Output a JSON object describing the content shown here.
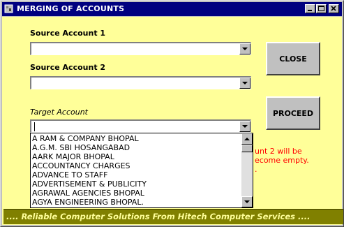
{
  "window": {
    "title": "MERGING OF ACCOUNTS",
    "titlebar_color": "#000080",
    "background_color": "#ffff99"
  },
  "source1": {
    "label": "Source Account 1",
    "value": ""
  },
  "source2": {
    "label": "Source Account 2",
    "value": ""
  },
  "target": {
    "label": "Target Account",
    "value": ""
  },
  "buttons": {
    "close_label": "CLOSE",
    "proceed_label": "PROCEED"
  },
  "notice": {
    "line1": "unt 2 will be",
    "line2": "ecome empty.",
    "line3": "."
  },
  "dropdown_items": [
    "A RAM & COMPANY BHOPAL",
    "A.G.M. SBI HOSANGABAD",
    "AARK MAJOR BHOPAL",
    "ACCOUNTANCY  CHARGES",
    "ADVANCE TO STAFF",
    "ADVERTISEMENT & PUBLICITY",
    "AGRAWAL AGENCIES BHOPAL",
    "AGYA ENGINEERING BHOPAL."
  ],
  "statusbar": {
    "text": ".... Reliable Computer Solutions From Hitech Computer Services ...."
  }
}
